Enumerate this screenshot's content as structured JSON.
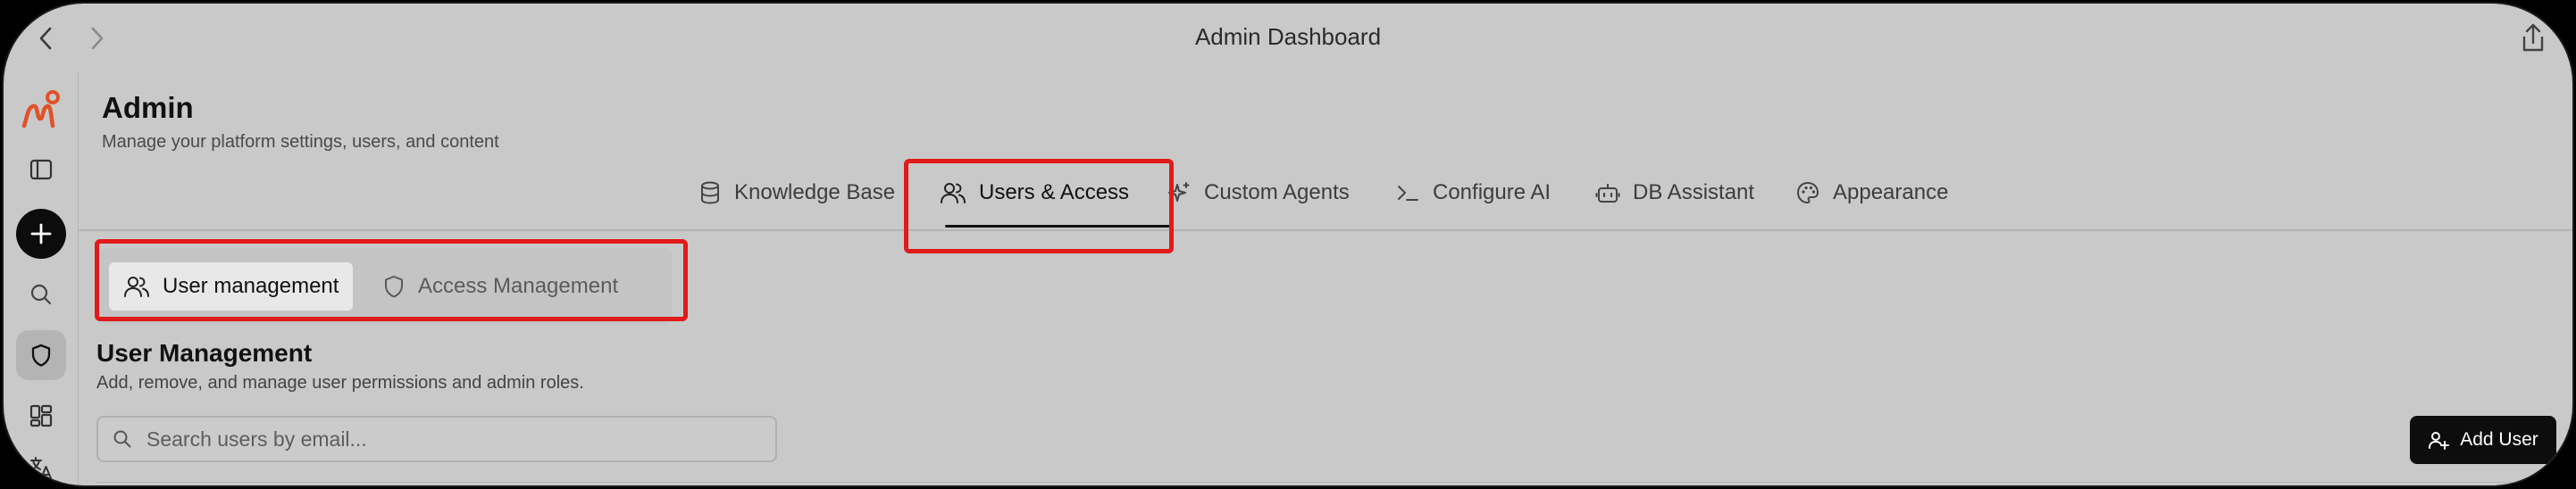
{
  "window": {
    "title": "Admin Dashboard"
  },
  "sidebar": {
    "items": [
      {
        "name": "logo",
        "icon": "brand-logo-icon"
      },
      {
        "name": "toggle-sidebar",
        "icon": "sidebar-panel-icon"
      },
      {
        "name": "new",
        "icon": "plus-icon"
      },
      {
        "name": "search",
        "icon": "search-icon"
      },
      {
        "name": "admin",
        "icon": "shield-icon",
        "active": true
      },
      {
        "name": "dashboard",
        "icon": "layout-grid-icon"
      },
      {
        "name": "translate",
        "icon": "translate-icon"
      }
    ]
  },
  "header": {
    "title": "Admin",
    "subtitle": "Manage your platform settings, users, and content"
  },
  "tabs": [
    {
      "label": "Knowledge Base",
      "icon": "database-icon"
    },
    {
      "label": "Users & Access",
      "icon": "users-icon",
      "active": true
    },
    {
      "label": "Custom Agents",
      "icon": "sparkles-icon"
    },
    {
      "label": "Configure AI",
      "icon": "terminal-icon"
    },
    {
      "label": "DB Assistant",
      "icon": "bot-icon"
    },
    {
      "label": "Appearance",
      "icon": "palette-icon"
    }
  ],
  "subtabs": [
    {
      "label": "User management",
      "icon": "users-icon",
      "active": true
    },
    {
      "label": "Access Management",
      "icon": "shield-icon"
    }
  ],
  "section": {
    "title": "User Management",
    "subtitle": "Add, remove, and manage user permissions and admin roles."
  },
  "search": {
    "placeholder": "Search users by email...",
    "value": ""
  },
  "actions": {
    "add_user_label": "Add User"
  },
  "colors": {
    "highlight": "#e11a1a",
    "brand": "#e0522a",
    "primary_button": "#0d0d0d"
  }
}
